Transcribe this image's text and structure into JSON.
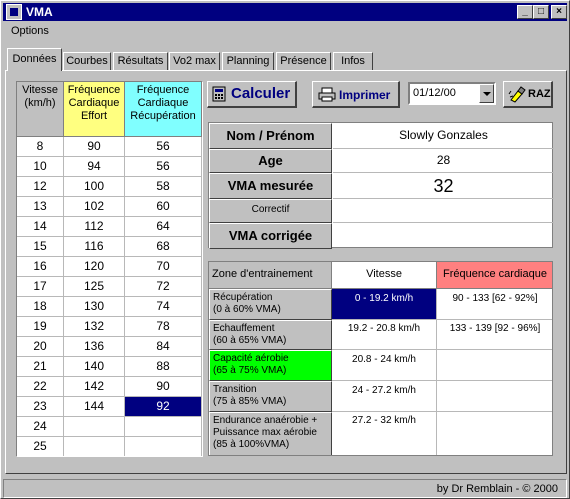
{
  "window": {
    "title": "VMA",
    "minimize": "_",
    "maximize": "□",
    "close": "×"
  },
  "menu": {
    "options": "Options"
  },
  "tabs": [
    "Données",
    "Courbes",
    "Résultats",
    "Vo2 max",
    "Planning",
    "Présence",
    "Infos"
  ],
  "grid": {
    "headers": [
      "Vitesse\n(km/h)",
      "Fréquence\nCardiaque\nEffort",
      "Fréquence\nCardiaque\nRécupération"
    ],
    "header_colors": [
      "#c0c0c0",
      "#ffff80",
      "#80ffff"
    ],
    "rows": [
      [
        "8",
        "90",
        "56"
      ],
      [
        "10",
        "94",
        "56"
      ],
      [
        "12",
        "100",
        "58"
      ],
      [
        "13",
        "102",
        "60"
      ],
      [
        "14",
        "112",
        "64"
      ],
      [
        "15",
        "116",
        "68"
      ],
      [
        "16",
        "120",
        "70"
      ],
      [
        "17",
        "125",
        "72"
      ],
      [
        "18",
        "130",
        "74"
      ],
      [
        "19",
        "132",
        "78"
      ],
      [
        "20",
        "136",
        "84"
      ],
      [
        "21",
        "140",
        "88"
      ],
      [
        "22",
        "142",
        "90"
      ],
      [
        "23",
        "144",
        "92"
      ],
      [
        "24",
        "",
        ""
      ],
      [
        "25",
        "",
        ""
      ]
    ],
    "selected_color": "#000080"
  },
  "toolbar": {
    "calculate": "Calculer",
    "print": "Imprimer",
    "date": "01/12/00",
    "reset": "RAZ"
  },
  "athlete": {
    "name_label": "Nom / Prénom",
    "name_value": "Slowly Gonzales",
    "age_label": "Age",
    "age_value": "28",
    "vma_label": "VMA mesurée",
    "vma_value": "32",
    "correction_label": "Correctif",
    "correction_value": "",
    "vma_corrected_label": "VMA corrigée",
    "vma_corrected_value": ""
  },
  "zones": {
    "headers": [
      "Zone d'entrainement",
      "Vitesse",
      "Fréquence cardiaque"
    ],
    "rows": [
      {
        "label": "Récupération\n(0 à 60% VMA)",
        "speed": "0 - 19.2 km/h",
        "hr": "90 - 133  [62 - 92%]"
      },
      {
        "label": "Echauffement\n(60 à 65% VMA)",
        "speed": "19.2 - 20.8 km/h",
        "hr": "133 - 139  [92 - 96%]"
      },
      {
        "label": "Capacité aérobie\n(65 à 75% VMA)",
        "speed": "20.8 - 24 km/h",
        "hr": ""
      },
      {
        "label": "Transition\n(75 à 85% VMA)",
        "speed": "24 - 27.2 km/h",
        "hr": ""
      },
      {
        "label": "Endurance anaérobie +\nPuissance max aérobie\n(85 à 100%VMA)",
        "speed": "27.2 - 32 km/h",
        "hr": ""
      }
    ],
    "hr_header_color": "#ff8080",
    "aerobic_color": "#00ff00",
    "selected_color": "#000080"
  },
  "status": {
    "credit": "by Dr Remblain - © 2000"
  }
}
